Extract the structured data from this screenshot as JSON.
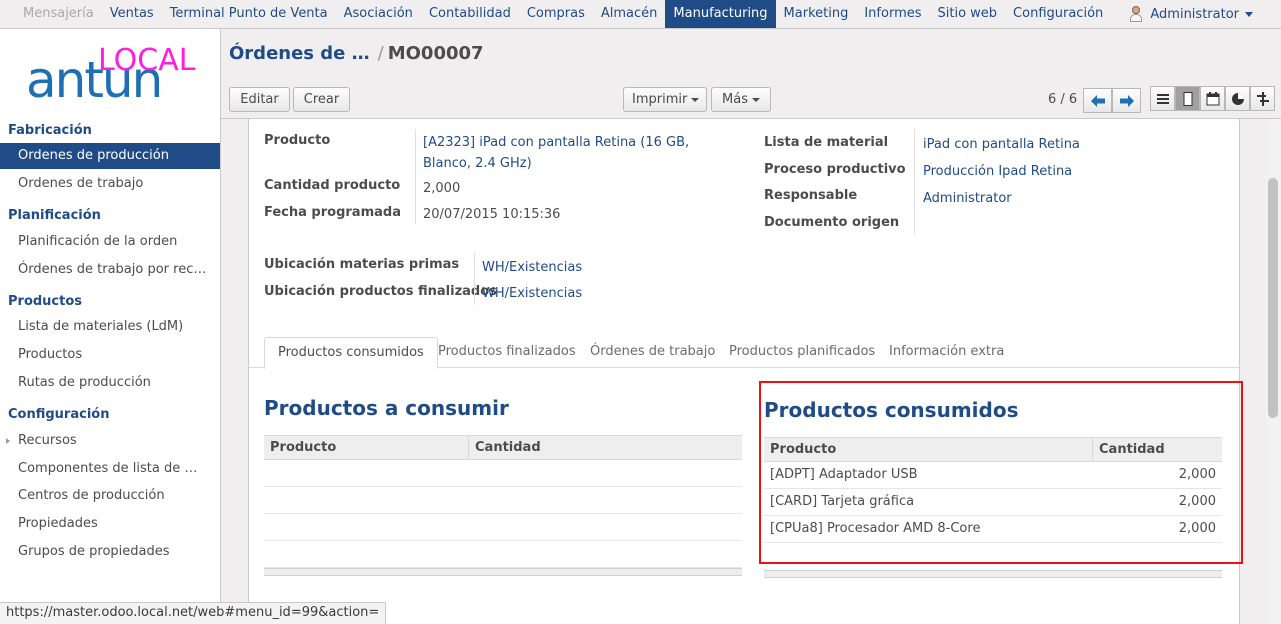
{
  "topmenu": {
    "items": [
      "Mensajería",
      "Ventas",
      "Terminal Punto de Venta",
      "Asociación",
      "Contabilidad",
      "Compras",
      "Almacén",
      "Manufacturing",
      "Marketing",
      "Informes",
      "Sitio web",
      "Configuración"
    ],
    "active": "Manufacturing",
    "user": "Administrator"
  },
  "logo": {
    "top": "LOCAL",
    "word": "antun"
  },
  "sidebar": {
    "sections": [
      {
        "title": "Fabricación",
        "items": [
          "Ordenes de producción",
          "Ordenes de trabajo"
        ]
      },
      {
        "title": "Planificación",
        "items": [
          "Planificación de la orden",
          "Órdenes de trabajo por rec…"
        ]
      },
      {
        "title": "Productos",
        "items": [
          "Lista de materiales (LdM)",
          "Productos",
          "Rutas de producción"
        ]
      },
      {
        "title": "Configuración",
        "items": [
          "Recursos",
          "Componentes de lista de …",
          "Centros de producción",
          "Propiedades",
          "Grupos de propiedades"
        ]
      }
    ],
    "active_item": "Ordenes de producción"
  },
  "breadcrumb": {
    "parent": "Órdenes de …",
    "separator": "/",
    "current": "MO00007"
  },
  "toolbar": {
    "edit": "Editar",
    "create": "Crear",
    "print": "Imprimir",
    "more": "Más",
    "pager": "6 / 6"
  },
  "views": [
    "list-icon",
    "form-icon",
    "calendar-icon",
    "graph-icon",
    "gantt-icon"
  ],
  "form": {
    "left": [
      {
        "label": "Producto",
        "value": "[A2323] iPad con pantalla Retina (16 GB, Blanco, 2.4 GHz)",
        "link": true
      },
      {
        "label": "Cantidad producto",
        "value": "2,000",
        "link": false
      },
      {
        "label": "Fecha programada",
        "value": "20/07/2015 10:15:36",
        "link": false
      }
    ],
    "right": [
      {
        "label": "Lista de material",
        "value": "iPad con pantalla Retina"
      },
      {
        "label": "Proceso productivo",
        "value": "Producción Ipad Retina"
      },
      {
        "label": "Responsable",
        "value": "Administrator"
      },
      {
        "label": "Documento origen",
        "value": ""
      }
    ],
    "locations": [
      {
        "label": "Ubicación materias primas",
        "value": "WH/Existencias"
      },
      {
        "label": "Ubicación productos finalizados",
        "value": "WH/Existencias"
      }
    ]
  },
  "tabs": [
    "Productos consumidos",
    "Productos finalizados",
    "Órdenes de trabajo",
    "Productos planificados",
    "Información extra"
  ],
  "to_consume": {
    "title": "Productos a consumir",
    "columns": [
      "Producto",
      "Cantidad"
    ],
    "rows": []
  },
  "consumed": {
    "title": "Productos consumidos",
    "columns": [
      "Producto",
      "Cantidad"
    ],
    "rows": [
      {
        "product": "[ADPT] Adaptador USB",
        "qty": "2,000"
      },
      {
        "product": "[CARD] Tarjeta gráfica",
        "qty": "2,000"
      },
      {
        "product": "[CPUa8] Procesador AMD 8-Core",
        "qty": "2,000"
      }
    ]
  },
  "statusbar": "https://master.odoo.local.net/web#menu_id=99&action=",
  "colors": {
    "brand": "#1f4c87",
    "highlight": "#e11111",
    "logo_top": "#ff1ee0",
    "logo_word": "#1f6fb4"
  }
}
